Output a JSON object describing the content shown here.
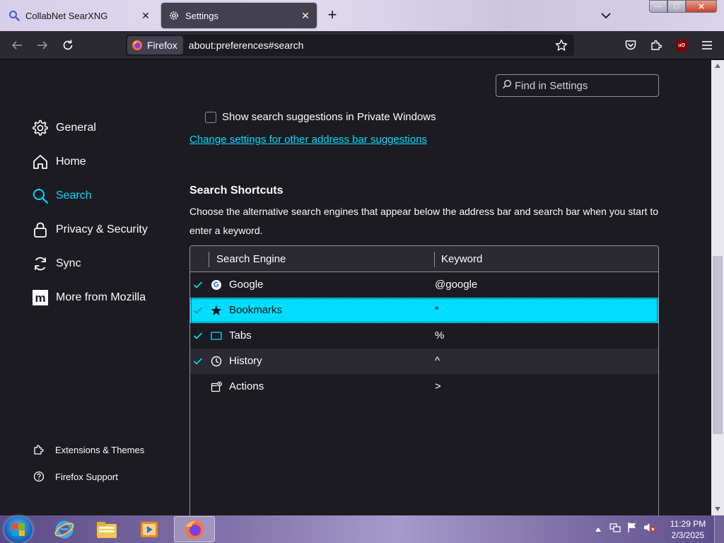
{
  "tabs": [
    {
      "label": "CollabNet SearXNG",
      "close": "✕"
    },
    {
      "label": "Settings",
      "close": "✕"
    }
  ],
  "newtab_symbol": "+",
  "window_controls": {
    "minimize": "—",
    "maximize": "□",
    "close": "✕"
  },
  "navbar": {
    "identity_label": "Firefox",
    "url": "about:preferences#search",
    "extension_badge": "uO"
  },
  "find": {
    "placeholder": "Find in Settings"
  },
  "sidebar": {
    "items": [
      {
        "label": "General",
        "icon": "gear-icon"
      },
      {
        "label": "Home",
        "icon": "home-icon"
      },
      {
        "label": "Search",
        "icon": "search-icon",
        "selected": true
      },
      {
        "label": "Privacy & Security",
        "icon": "lock-icon"
      },
      {
        "label": "Sync",
        "icon": "sync-icon"
      },
      {
        "label": "More from Mozilla",
        "icon": "mozilla-icon"
      }
    ],
    "footer": [
      {
        "label": "Extensions & Themes",
        "icon": "puzzle-icon"
      },
      {
        "label": "Firefox Support",
        "icon": "help-icon"
      }
    ]
  },
  "main": {
    "private_suggestions_label": "Show search suggestions in Private Windows",
    "address_bar_link": "Change settings for other address bar suggestions",
    "shortcuts_heading": "Search Shortcuts",
    "shortcuts_desc": "Choose the alternative search engines that appear below the address bar and search bar when you start to enter a keyword.",
    "table": {
      "columns": [
        "Search Engine",
        "Keyword"
      ],
      "rows": [
        {
          "checked": true,
          "name": "Google",
          "keyword": "@google",
          "icon": "google-icon"
        },
        {
          "checked": true,
          "name": "Bookmarks",
          "keyword": "*",
          "icon": "star-icon",
          "selected": true
        },
        {
          "checked": true,
          "name": "Tabs",
          "keyword": "%",
          "icon": "tab-icon"
        },
        {
          "checked": true,
          "name": "History",
          "keyword": "^",
          "icon": "clock-icon"
        },
        {
          "checked": false,
          "name": "Actions",
          "keyword": ">",
          "icon": "actions-icon"
        }
      ]
    }
  },
  "taskbar": {
    "time": "11:29 PM",
    "date": "2/3/2025"
  },
  "colors": {
    "accent": "#00ddff",
    "background": "#1c1b22",
    "surface": "#2b2a33"
  }
}
